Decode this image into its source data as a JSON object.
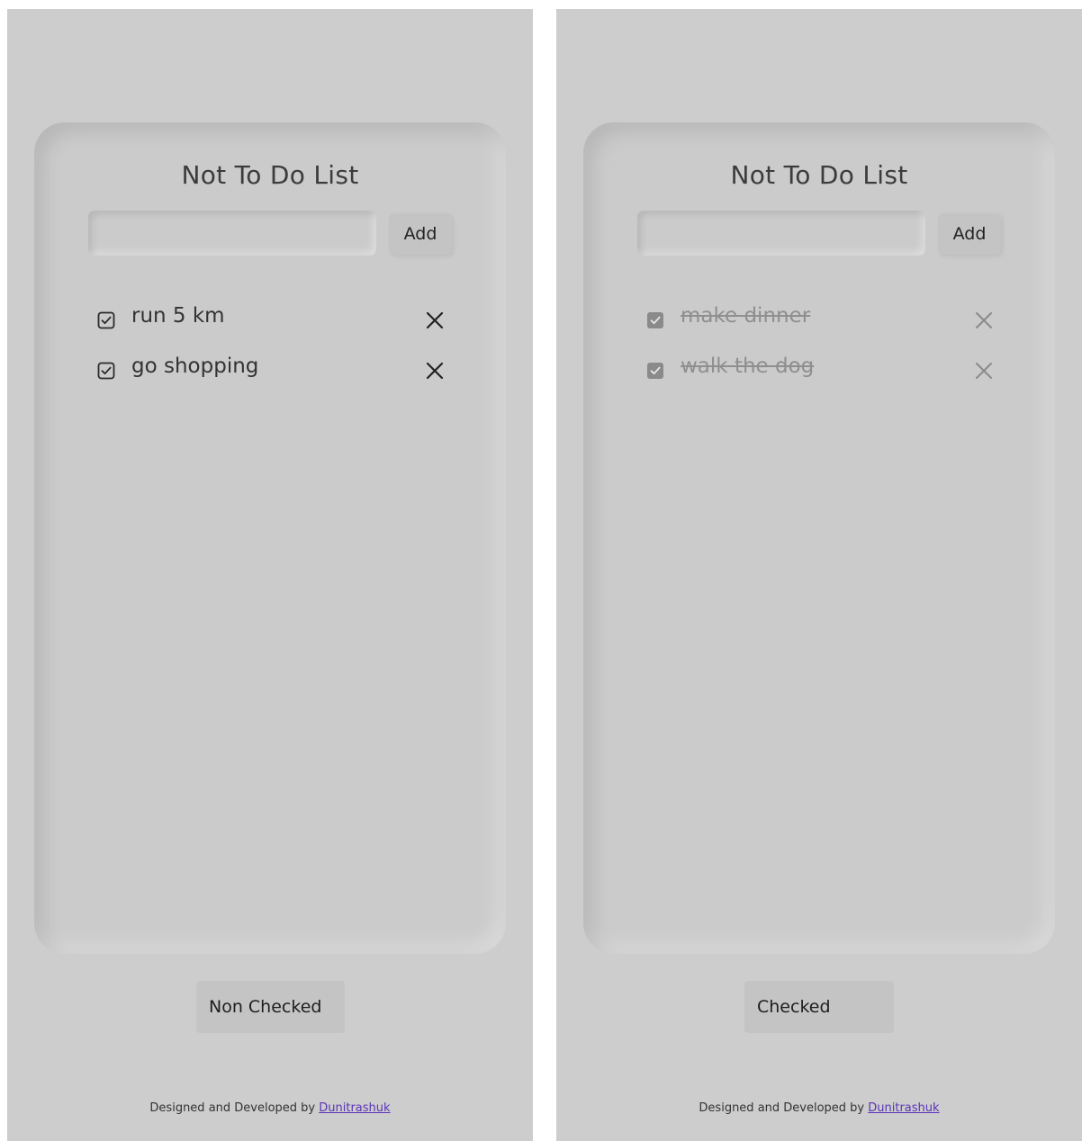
{
  "screens": [
    {
      "title": "Not To Do List",
      "input": {
        "value": "",
        "placeholder": ""
      },
      "add_label": "Add",
      "items": [
        {
          "text": "run 5 km",
          "checked": false
        },
        {
          "text": "go shopping",
          "checked": false
        }
      ],
      "filter_label": "Non Checked",
      "footer": {
        "text": "Designed and Developed by",
        "link": "Dunitrashuk"
      }
    },
    {
      "title": "Not To Do List",
      "input": {
        "value": "",
        "placeholder": ""
      },
      "add_label": "Add",
      "items": [
        {
          "text": "make dinner",
          "checked": true
        },
        {
          "text": "walk the dog",
          "checked": true
        }
      ],
      "filter_label": "Checked",
      "footer": {
        "text": "Designed and Developed by",
        "link": "Dunitrashuk"
      }
    }
  ],
  "colors": {
    "background": "#cdcdcd",
    "card": "#cbcbcb",
    "button": "#c4c4c4",
    "done_text": "#8f8f8f",
    "link": "#5b34b8"
  },
  "icons": {
    "unchecked": "checkbox-icon",
    "checked": "checkbox-checked-icon",
    "remove": "close-icon"
  }
}
